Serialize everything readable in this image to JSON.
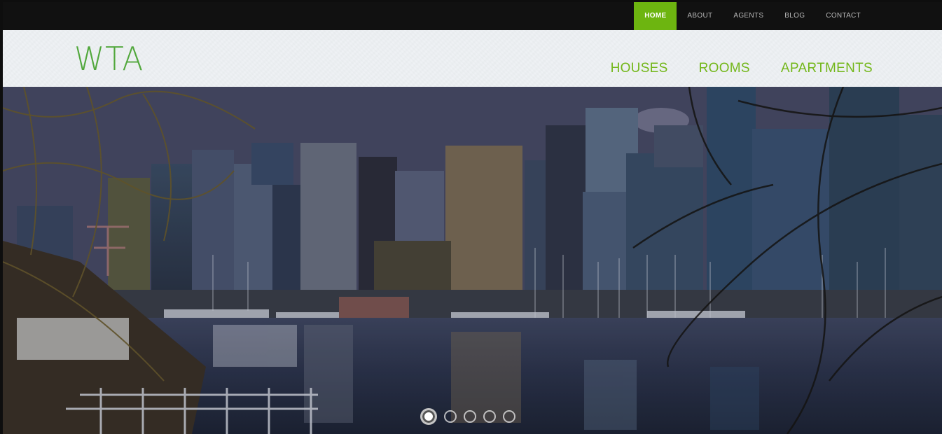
{
  "top_nav": {
    "items": [
      {
        "label": "HOME",
        "active": true
      },
      {
        "label": "ABOUT",
        "active": false
      },
      {
        "label": "AGENTS",
        "active": false
      },
      {
        "label": "BLOG",
        "active": false
      },
      {
        "label": "CONTACT",
        "active": false
      }
    ]
  },
  "header": {
    "logo_text": "WTA",
    "main_nav": [
      "HOUSES",
      "ROOMS",
      "APARTMENTS"
    ]
  },
  "hero": {
    "slides_count": 5,
    "active_slide": 1
  },
  "colors": {
    "accent": "#6db510",
    "logo": "#52a83d",
    "nav_link": "#73b71a",
    "top_bar": "#111111",
    "header_bg": "#eef1f4"
  }
}
